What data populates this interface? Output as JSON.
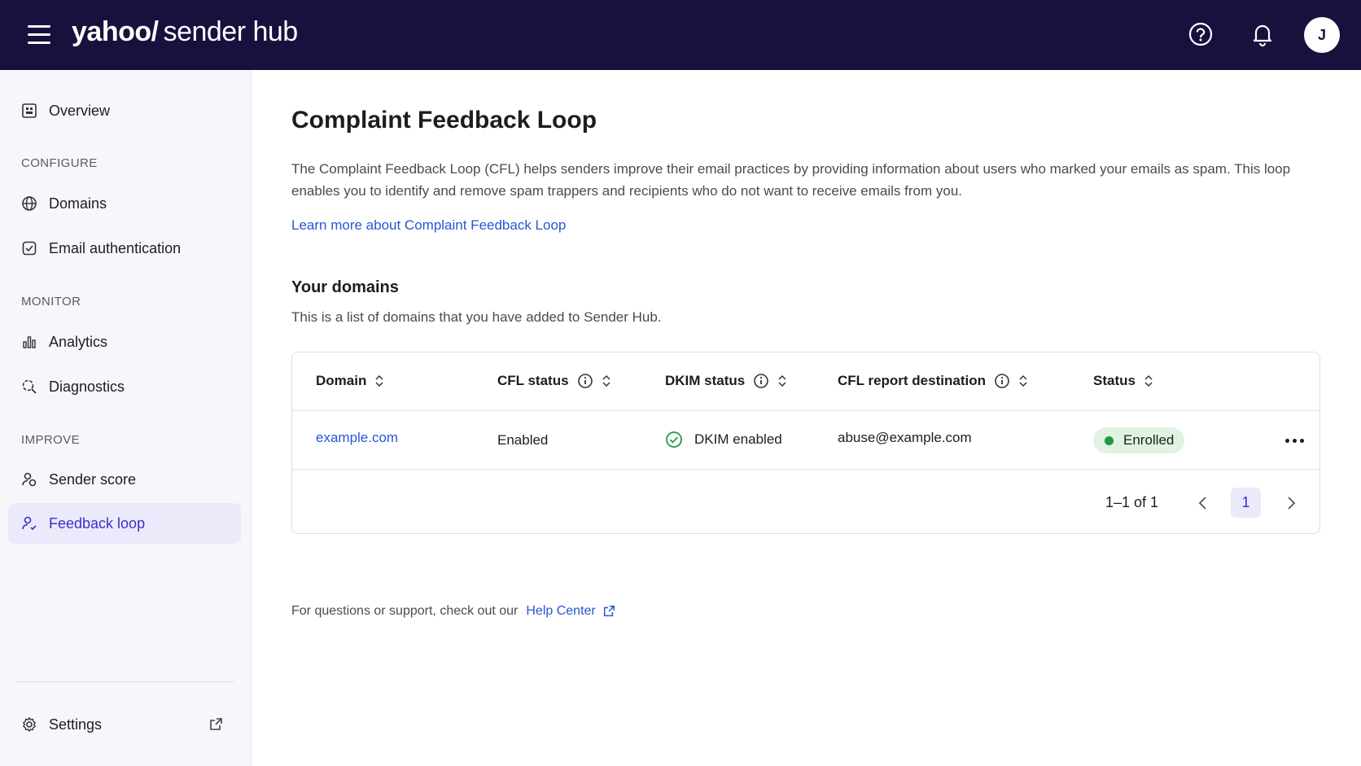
{
  "header": {
    "logo_brand": "yahoo/",
    "logo_product": "sender hub",
    "avatar_initial": "J",
    "icons": [
      "menu-icon",
      "help-icon",
      "bell-icon"
    ]
  },
  "sidebar": {
    "overview": "Overview",
    "configure_label": "CONFIGURE",
    "domains": "Domains",
    "email_auth": "Email authentication",
    "monitor_label": "MONITOR",
    "analytics": "Analytics",
    "diagnostics": "Diagnostics",
    "improve_label": "IMPROVE",
    "sender_score": "Sender score",
    "feedback_loop": "Feedback loop",
    "settings": "Settings"
  },
  "main": {
    "title": "Complaint Feedback Loop",
    "description": "The Complaint Feedback Loop (CFL) helps senders improve their email practices by providing information about users who marked your emails as spam. This loop enables you to identify and remove spam trappers and recipients who do not want to receive emails from you.",
    "learn_more": "Learn more about Complaint Feedback Loop",
    "domains_title": "Your domains",
    "domains_subtitle": "This is a list of domains that you have added to Sender Hub.",
    "table": {
      "columns": {
        "domain": "Domain",
        "cfl_status": "CFL status",
        "dkim_status": "DKIM status",
        "cfl_report_destination": "CFL report destination",
        "status": "Status"
      },
      "rows": [
        {
          "domain": "example.com",
          "cfl_status": "Enabled",
          "dkim_status": "DKIM enabled",
          "cfl_report_destination": "abuse@example.com",
          "status": "Enrolled"
        }
      ],
      "pagination": {
        "range": "1–1 of 1",
        "current_page": "1"
      }
    },
    "support_text": "For questions or support, check out our",
    "help_center": "Help Center"
  },
  "colors": {
    "header_bg": "#16113d",
    "accent": "#3d2fc9",
    "link": "#2458d3",
    "success": "#1f9a3e",
    "success_bg": "#dff3e2"
  }
}
